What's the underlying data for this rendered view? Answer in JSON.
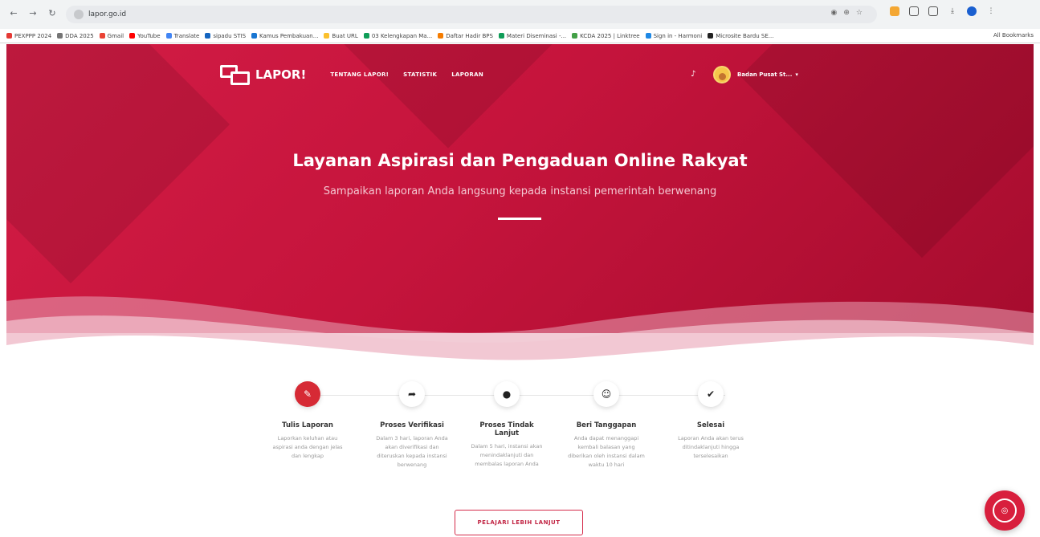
{
  "browser": {
    "nav": {
      "back": "←",
      "forward": "→",
      "reload": "↻"
    },
    "url": "lapor.go.id",
    "bookmarks": [
      {
        "label": "PEXPPP 2024",
        "color": "#e53935"
      },
      {
        "label": "DDA 2025",
        "color": "#757575"
      },
      {
        "label": "Gmail",
        "color": "#ea4335"
      },
      {
        "label": "YouTube",
        "color": "#ff0000"
      },
      {
        "label": "Translate",
        "color": "#4285f4"
      },
      {
        "label": "sipadu STIS",
        "color": "#1565c0"
      },
      {
        "label": "Kamus Pembakuan...",
        "color": "#1976d2"
      },
      {
        "label": "Buat URL",
        "color": "#fbc02d"
      },
      {
        "label": "03 Kelengkapan Ma...",
        "color": "#0f9d58"
      },
      {
        "label": "Daftar Hadir BPS",
        "color": "#f57c00"
      },
      {
        "label": "Materi Diseminasi -...",
        "color": "#0f9d58"
      },
      {
        "label": "KCDA 2025 | Linktree",
        "color": "#43a047"
      },
      {
        "label": "Sign in - Harmoni",
        "color": "#1e88e5"
      },
      {
        "label": "Microsite Bardu SE...",
        "color": "#212121"
      }
    ],
    "all_bookmarks": "All Bookmarks"
  },
  "header": {
    "logo": "LAPOR!",
    "menu": [
      "TENTANG LAPOR!",
      "STATISTIK",
      "LAPORAN"
    ],
    "user": "Badan Pusat St..."
  },
  "hero": {
    "title": "Layanan Aspirasi dan Pengaduan Online Rakyat",
    "subtitle": "Sampaikan laporan Anda langsung kepada instansi pemerintah berwenang"
  },
  "steps": [
    {
      "icon": "✎",
      "title": "Tulis Laporan",
      "desc": "Laporkan keluhan atau aspirasi anda dengan jelas dan lengkap"
    },
    {
      "icon": "➦",
      "title": "Proses Verifikasi",
      "desc": "Dalam 3 hari, laporan Anda akan diverifikasi dan diteruskan kepada instansi berwenang"
    },
    {
      "icon": "●",
      "title": "Proses Tindak Lanjut",
      "desc": "Dalam 5 hari, instansi akan menindaklanjuti dan membalas laporan Anda"
    },
    {
      "icon": "☺",
      "title": "Beri Tanggapan",
      "desc": "Anda dapat menanggapi kembali balasan yang diberikan oleh instansi dalam waktu 10 hari"
    },
    {
      "icon": "✔",
      "title": "Selesai",
      "desc": "Laporan Anda akan terus ditindaklanjuti hingga terselesaikan"
    }
  ],
  "cta": "PELAJARI LEBIH LANJUT",
  "colors": {
    "primary": "#cc1a43",
    "accent": "#d62a35"
  }
}
